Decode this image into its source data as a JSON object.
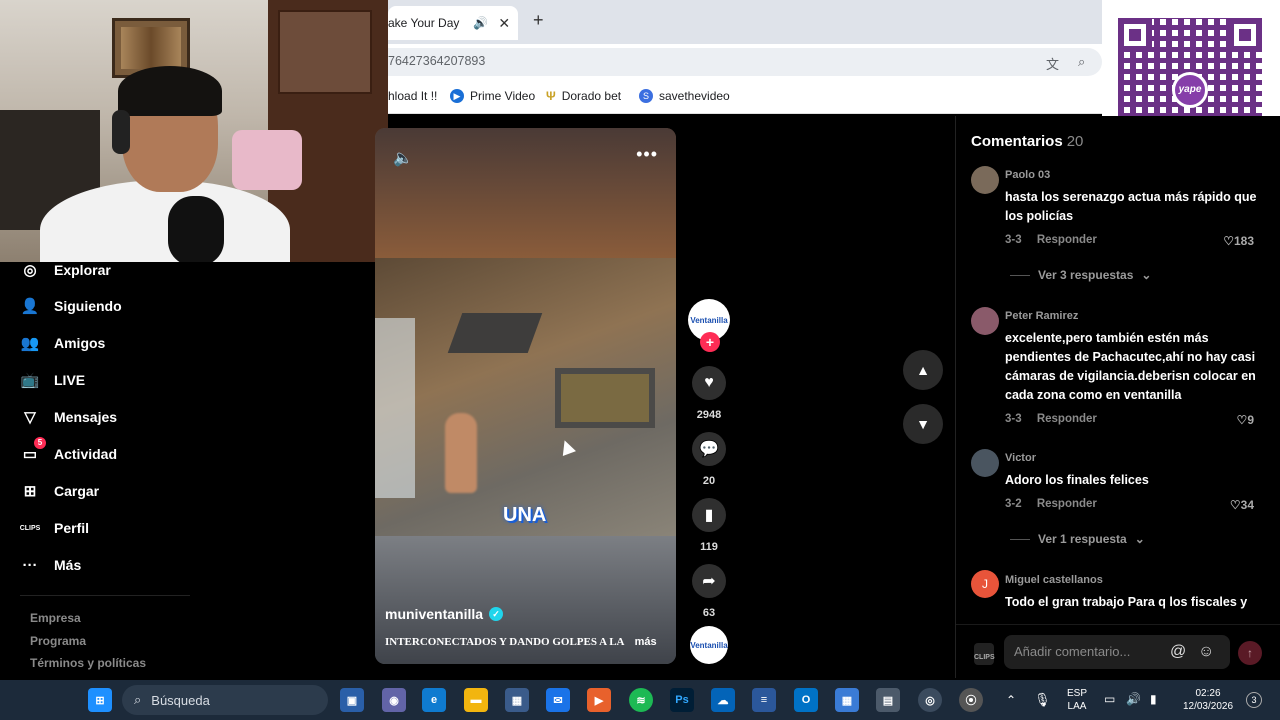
{
  "browser": {
    "tab_title": "ake Your Day",
    "address": "76427364207893",
    "bookmarks": [
      {
        "label": "hload It !!",
        "icon": "none"
      },
      {
        "label": "Prime Video",
        "icon": "play-icon"
      },
      {
        "label": "Dorado bet",
        "icon": "bet-icon"
      },
      {
        "label": "savethevideo",
        "icon": "s-icon"
      }
    ]
  },
  "qr": {
    "logo_text": "yape"
  },
  "sidebar": {
    "items": [
      {
        "label": "Explorar",
        "icon": "compass-icon"
      },
      {
        "label": "Siguiendo",
        "icon": "following-icon"
      },
      {
        "label": "Amigos",
        "icon": "friends-icon"
      },
      {
        "label": "LIVE",
        "icon": "live-icon"
      },
      {
        "label": "Mensajes",
        "icon": "send-icon"
      },
      {
        "label": "Actividad",
        "icon": "inbox-icon",
        "badge": "5"
      },
      {
        "label": "Cargar",
        "icon": "upload-icon"
      },
      {
        "label": "Perfil",
        "icon": "profile-icon"
      },
      {
        "label": "Más",
        "icon": "more-icon"
      }
    ],
    "footer": [
      "Empresa",
      "Programa",
      "Términos y políticas"
    ]
  },
  "video": {
    "caption_word": "UNA",
    "author": "muniventanilla",
    "description": "INTERCONECTADOS Y DANDO GOLPES A LA",
    "more_label": "más",
    "avatar_text": "Ventanilla",
    "likes": "2948",
    "comments": "20",
    "saves": "119",
    "shares": "63"
  },
  "comments": {
    "title": "Comentarios",
    "count": "20",
    "items": [
      {
        "user": "Paolo 03",
        "text": "hasta los serenazgo actua más rápido que los policías",
        "date": "3-3",
        "reply": "Responder",
        "likes": "183",
        "avatar_color": "#7a6a5a",
        "view_replies": "Ver 3 respuestas"
      },
      {
        "user": "Peter Ramirez",
        "text": "excelente,pero también estén más pendientes de Pachacutec,ahí no hay casi cámaras de vigilancia.deberisn colocar en cada zona como en ventanilla",
        "date": "3-3",
        "reply": "Responder",
        "likes": "9",
        "avatar_color": "#8a5a6a"
      },
      {
        "user": "Victor",
        "text": "Adoro los finales felices",
        "date": "3-2",
        "reply": "Responder",
        "likes": "34",
        "avatar_color": "#4a5560",
        "view_replies": "Ver 1 respuesta"
      },
      {
        "user": "Miguel castellanos",
        "text": "Todo el gran trabajo Para q los fiscales y",
        "avatar_letter": "J",
        "avatar_color": "#e8543a"
      }
    ],
    "input_placeholder": "Añadir comentario..."
  },
  "taskbar": {
    "search_label": "Búsqueda",
    "lang_top": "ESP",
    "lang_bottom": "LAA",
    "time": "02:26",
    "date": "12/03/2026",
    "notifications": "3"
  }
}
